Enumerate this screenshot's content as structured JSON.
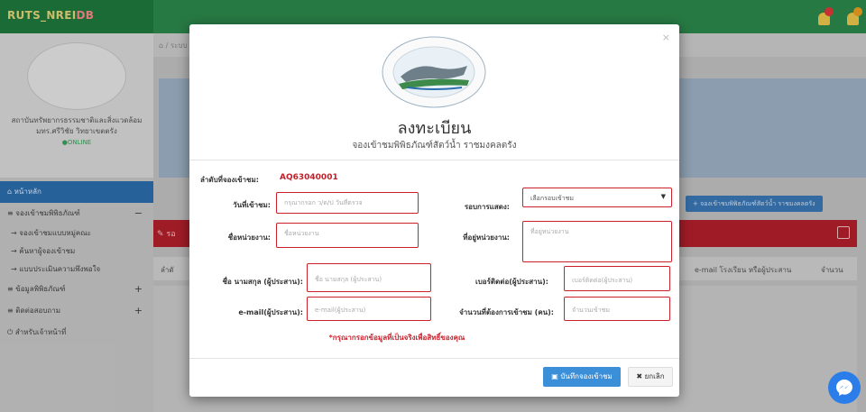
{
  "header": {
    "brand_a": "RUT",
    "brand_b": "S_NREI",
    "brand_c": "DB"
  },
  "sidebar": {
    "org_line1": "สถาบันทรัพยากรธรรมชาติและสิ่งแวดล้อม",
    "org_line2": "มทร.ศรีวิชัย วิทยาเขตตรัง",
    "status": "ONLINE",
    "items": [
      {
        "label": "หน้าหลัก"
      },
      {
        "label": "จองเข้าชมพิพิธภัณฑ์"
      },
      {
        "label": "ข้อมูลพิพิธภัณฑ์"
      },
      {
        "label": "ติดต่อสอบถาม"
      },
      {
        "label": "สำหรับเจ้าหน้าที่"
      }
    ],
    "sub_items": [
      {
        "label": "จองเข้าชมแบบหมู่คณะ"
      },
      {
        "label": "ค้นหาผู้จองเข้าชม"
      },
      {
        "label": "แบบประเมินความพึงพอใจ"
      }
    ]
  },
  "content": {
    "breadcrumb": "ระบบ",
    "tour_button": "จองเข้าชมพิพิธภัณฑ์สัตว์น้ำ ราชมงคลตรัง",
    "panel_title": "รอ",
    "col_first": "ลำดั",
    "col_email": "e-mail โรงเรียน หรือผู้ประสาน",
    "col_count": "จำนวน"
  },
  "modal": {
    "close": "×",
    "title": "ลงทะเบียน",
    "subtitle": "จองเข้าชมพิพิธภัณฑ์สัตว์น้ำ ราชมงคลตรัง",
    "booking_no_label": "ลำดับที่จองเข้าชม:",
    "booking_no": "AQ63040001",
    "visit_date_label": "วันที่เข้าชม:",
    "visit_date_ph": "กรุณากรอก ว/ด/ป วันที่ตรวจ",
    "round_label": "รอบการแสดง:",
    "round_value": "เลือกรอบเข้าชม",
    "org_label": "ชื่อหน่วยงาน:",
    "org_ph": "ชื่อหน่วยงาน",
    "address_label": "ที่อยู่หน่วยงาน:",
    "address_ph": "ที่อยู่หน่วยงาน",
    "name_label": "ชื่อ นามสกุล (ผู้ประสาน):",
    "name_ph": "ชื่อ นามสกุล (ผู้ประสาน)",
    "phone_label": "เบอร์ติดต่อ(ผู้ประสาน):",
    "phone_ph": "เบอร์ติดต่อ(ผู้ประสาน)",
    "email_label": "e-mail(ผู้ประสาน):",
    "email_ph": "e-mail(ผู้ประสาน)",
    "count_label": "จำนวนที่ต้องการเข้าชม (คน):",
    "count_ph": "จำนวนเข้าชม",
    "note": "*กรุณากรอกข้อมูลที่เป็นจริงเพื่อสิทธิ์ของคุณ",
    "save_label": "บันทึกจองเข้าชม",
    "cancel_label": "ยกเลิก"
  },
  "colors": {
    "accent": "#cc1f2a",
    "primary": "#3b8fd9",
    "header": "#2d8a4e"
  }
}
